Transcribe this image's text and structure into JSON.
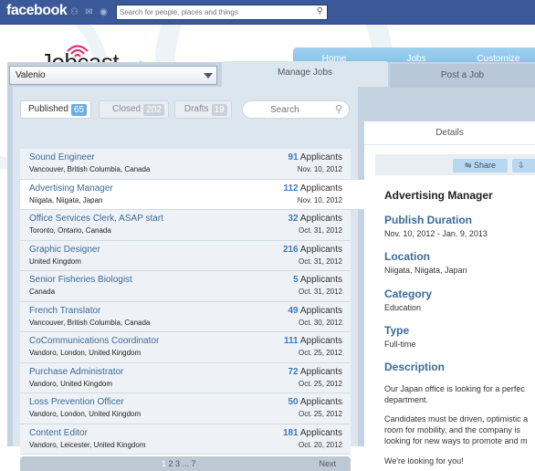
{
  "facebook": {
    "logo": "facebook",
    "search_placeholder": "Search for people, places and things"
  },
  "app": {
    "logo_main": "Jobcast",
    "logo_suffix": ".net",
    "nav": [
      "Home",
      "Jobs",
      "Customize"
    ]
  },
  "account": {
    "selected": "Valenio"
  },
  "tabs": {
    "manage": "Manage Jobs",
    "post": "Post a Job"
  },
  "filters": {
    "published": {
      "label": "Published",
      "count": "65"
    },
    "closed": {
      "label": "Closed",
      "count": "202"
    },
    "drafts": {
      "label": "Drafts",
      "count": "19"
    },
    "search_placeholder": "Search"
  },
  "jobs": [
    {
      "title": "Sound Engineer",
      "location": "Vancouver, British Columbia, Canada",
      "count": "91",
      "applicants_label": "Applicants",
      "date": "Nov. 10, 2012"
    },
    {
      "title": "Advertising Manager",
      "location": "Niigata, Niigata, Japan",
      "count": "112",
      "applicants_label": "Applicants",
      "date": "Nov. 10, 2012"
    },
    {
      "title": "Office Services Clerk, ASAP start",
      "location": "Toronto, Ontario, Canada",
      "count": "32",
      "applicants_label": "Applicants",
      "date": "Oct. 31, 2012"
    },
    {
      "title": "Graphic Designer",
      "location": "United Kingdom",
      "count": "216",
      "applicants_label": "Applicants",
      "date": "Oct. 31, 2012"
    },
    {
      "title": "Senior Fisheries Biologist",
      "location": "Canada",
      "count": "5",
      "applicants_label": "Applicants",
      "date": "Oct. 31, 2012"
    },
    {
      "title": "French Translator",
      "location": "Vancouver, British Columbia, Canada",
      "count": "49",
      "applicants_label": "Applicants",
      "date": "Oct. 30, 2012"
    },
    {
      "title": "CoCommunications Coordinator",
      "location": "Vandoro, London, United Kingdom",
      "count": "111",
      "applicants_label": "Applicants",
      "date": "Oct. 25, 2012"
    },
    {
      "title": "Purchase Administrator",
      "location": "Vandoro, United Kingdom",
      "count": "72",
      "applicants_label": "Applicants",
      "date": "Oct. 25, 2012"
    },
    {
      "title": "Loss Prevention Officer",
      "location": "Vandoro, London, United Kingdom",
      "count": "50",
      "applicants_label": "Applicants",
      "date": "Oct. 25, 2012"
    },
    {
      "title": "Content Editor",
      "location": "Vandoro, Leicester, United Kingdom",
      "count": "181",
      "applicants_label": "Applicants",
      "date": "Oct. 20, 2012"
    }
  ],
  "pager": {
    "current": "1",
    "pages": "2 3 ... 7",
    "next": "Next"
  },
  "details": {
    "header": "Details",
    "share": "Share",
    "title": "Advertising Manager",
    "publish_label": "Publish Duration",
    "publish_value": "Nov. 10, 2012 - Jan. 9, 2013",
    "location_label": "Location",
    "location_value": "Niigata, Niigata, Japan",
    "category_label": "Category",
    "category_value": "Education",
    "type_label": "Type",
    "type_value": "Full-time",
    "description_label": "Description",
    "desc1a": "Our Japan office is looking for a perfec",
    "desc1b": "department.",
    "desc2a": "Candidates must be driven, optimistic a",
    "desc2b": "room for mobility, and the company is",
    "desc2c": "looking for new ways to promote and m",
    "desc3": "We're looking for you!"
  },
  "colors": {
    "facebook_blue": "#3b5998",
    "nav_blue": "#7cbde6",
    "link_blue": "#3a6b9a"
  }
}
